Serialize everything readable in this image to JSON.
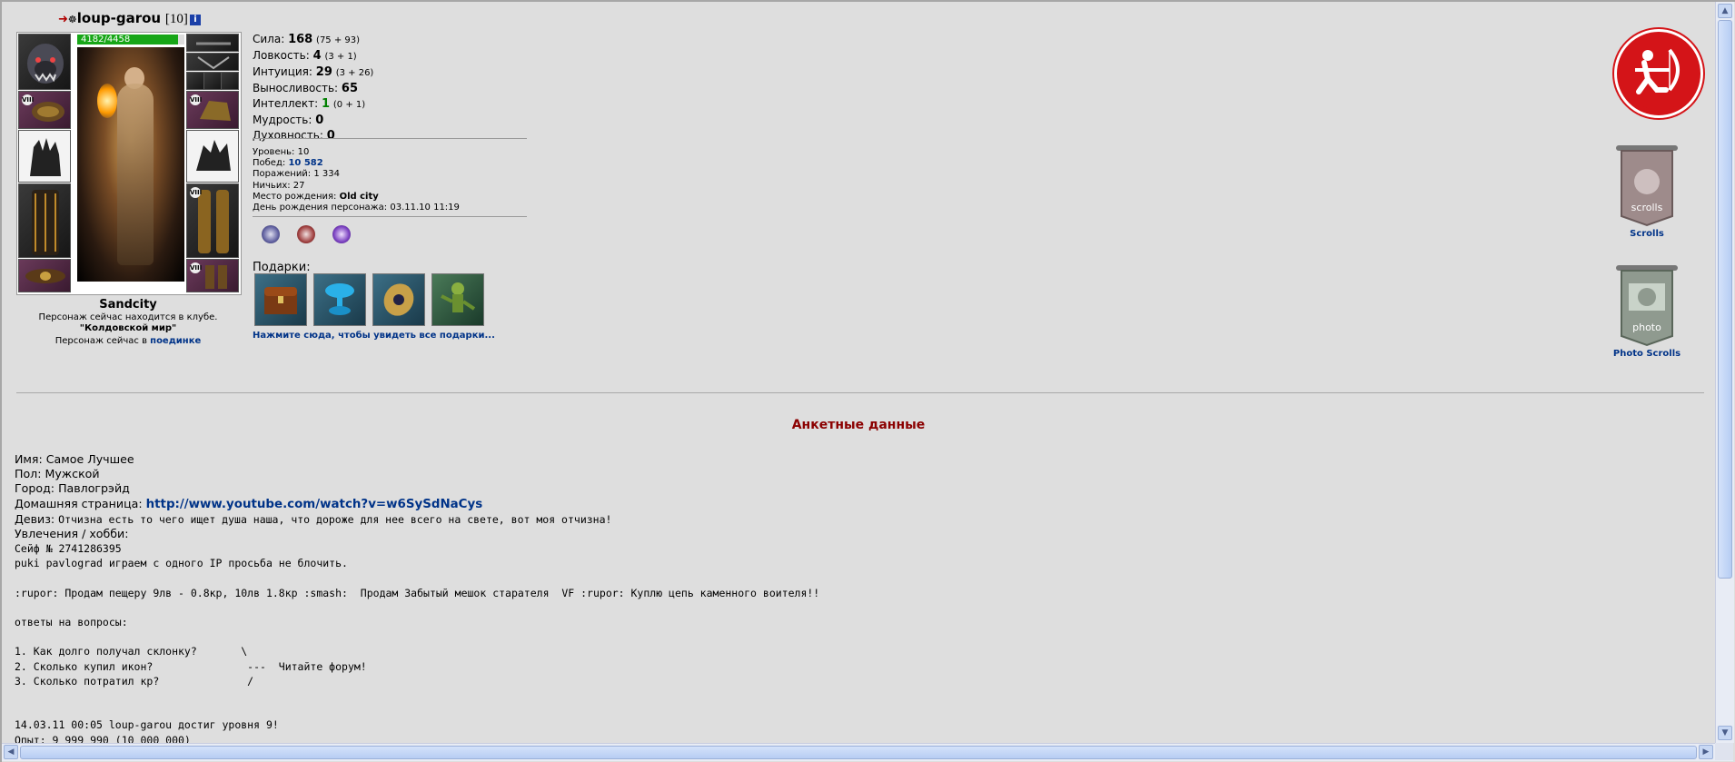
{
  "header": {
    "nick": "loup-garou",
    "level": "[10]",
    "info_icon": "i"
  },
  "doll": {
    "hp_text": "4182/4458",
    "hp_fraction": 0.938,
    "slot_badge": "VIII"
  },
  "club": {
    "name": "Sandcity",
    "line1": "Персонаж сейчас находится в клубе.",
    "room": "\"Колдовской мир\"",
    "line3_prefix": "Персонаж сейчас в",
    "line3_link": "поединке"
  },
  "stats": [
    {
      "label": "Сила:",
      "value": "168",
      "extra": "(75 + 93)",
      "green": false
    },
    {
      "label": "Ловкость:",
      "value": "4",
      "extra": "(3 + 1)",
      "green": false
    },
    {
      "label": "Интуиция:",
      "value": "29",
      "extra": "(3 + 26)",
      "green": false
    },
    {
      "label": "Выносливость:",
      "value": "65",
      "extra": "",
      "green": false
    },
    {
      "label": "Интеллект:",
      "value": "1",
      "extra": "(0 + 1)",
      "green": true
    },
    {
      "label": "Мудрость:",
      "value": "0",
      "extra": "",
      "green": false
    },
    {
      "label": "Духовность:",
      "value": "0",
      "extra": "",
      "green": false
    }
  ],
  "info": {
    "level_label": "Уровень:",
    "level_value": "10",
    "wins_label": "Побед:",
    "wins_value": "10 582",
    "losses_label": "Поражений:",
    "losses_value": "1 334",
    "draws_label": "Ничьих:",
    "draws_value": "27",
    "birthplace_label": "Место рождения:",
    "birthplace_value": "Old city",
    "birthday_label": "День рождения персонажа:",
    "birthday_value": "03.11.10 11:19"
  },
  "gifts": {
    "title": "Подарки:",
    "link": "Нажмите сюда, чтобы увидеть все подарки..."
  },
  "right_icons": {
    "scrolls_label": "Scrolls",
    "scrolls_text": "scrolls",
    "photo_label": "Photo Scrolls",
    "photo_text": "photo"
  },
  "anketa": {
    "title": "Анкетные данные",
    "name_label": "Имя:",
    "name_value": "Самое Лучшее",
    "gender_label": "Пол:",
    "gender_value": "Мужской",
    "city_label": "Город:",
    "city_value": "Павлогрэйд",
    "home_label": "Домашняя страница:",
    "home_url": "http://www.youtube.com/watch?v=w6SySdNaCys",
    "motto_label": "Девиз:",
    "motto_value": "Отчизна есть то чего ищет душа наша, что дороже для нее всего на свете, вот моя отчизна!",
    "hobby_label": "Увлечения / хобби:",
    "about_text": "Сейф № 2741286395\npuki pavlograd играем с одного IP просьба не блочить.\n\n:rupor: Продам пещеру 9лв - 0.8кр, 10лв 1.8кр :smash:  Продам Забытый мешок старателя  VF :rupor: Куплю цепь каменного воителя!!\n\nответы на вопросы:\n\n1. Как долго получал склонку?       \\\n2. Сколько купил икон?               ---  Читайте форум!\n3. Сколько потратил кр?              /\n\n\n14.03.11 00:05 loup-garou достиг уровня 9!\nОпыт: 9 999 990 (10 000 000)"
  },
  "colors": {
    "background": "#dedede",
    "link": "#003388",
    "section_title": "#8b0000",
    "hp": "#17a617",
    "archer_red": "#d41418"
  }
}
